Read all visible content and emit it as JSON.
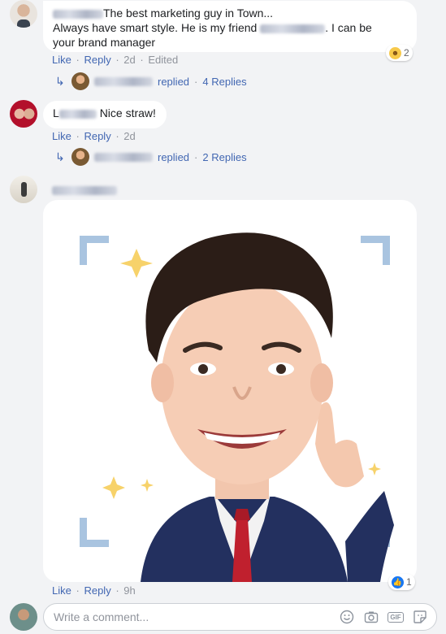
{
  "comment1": {
    "text_line1": "The best marketing guy in Town...",
    "text_line2_before": "Always have smart style. He is my friend",
    "text_line2_after": ". I can be",
    "text_line3": "your brand manager",
    "actions": {
      "like": "Like",
      "reply": "Reply",
      "time": "2d",
      "edited": "Edited"
    },
    "reaction": {
      "icon": "haha-emoji-icon",
      "count": "2"
    },
    "replies": {
      "label": "replied",
      "count": "4 Replies"
    }
  },
  "comment2": {
    "text_prefix": "L",
    "text": "Nice straw!",
    "actions": {
      "like": "Like",
      "reply": "Reply",
      "time": "2d"
    },
    "replies": {
      "label": "replied",
      "count": "2 Replies"
    }
  },
  "comment3": {
    "actions": {
      "like": "Like",
      "reply": "Reply",
      "time": "9h"
    },
    "reaction": {
      "icon": "like-icon",
      "count": "1"
    }
  },
  "separator": "·",
  "composer": {
    "placeholder": "Write a comment...",
    "icons": [
      "emoji-icon",
      "camera-icon",
      "gif-icon",
      "sticker-icon"
    ],
    "gif_label": "GIF"
  },
  "colors": {
    "link": "#4267b2",
    "meta": "#90949c",
    "background": "#f2f3f5"
  }
}
